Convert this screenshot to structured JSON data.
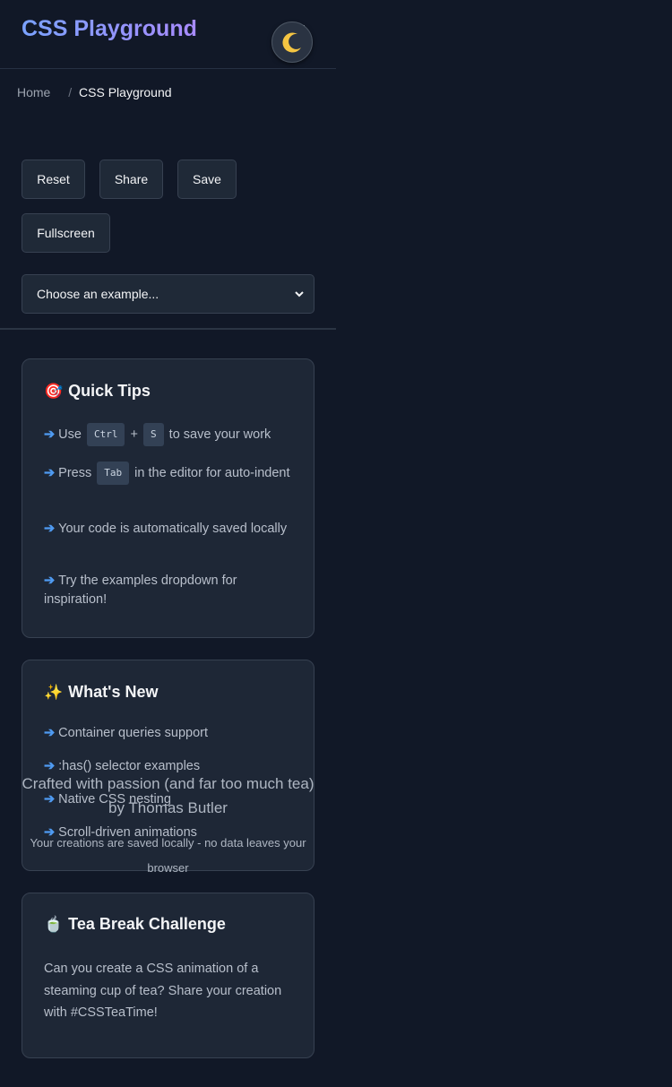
{
  "header": {
    "title": "CSS Playground"
  },
  "breadcrumb": {
    "home": "Home",
    "separator": "/",
    "current": "CSS Playground"
  },
  "toolbar": {
    "reset": "Reset",
    "share": "Share",
    "save": "Save",
    "fullscreen": "Fullscreen"
  },
  "examples_select": {
    "selected": "Choose an example..."
  },
  "quick_tips": {
    "emoji": "🎯",
    "title": "Quick Tips",
    "arrow": "➔",
    "tip1": {
      "before": "Use",
      "key1": "Ctrl",
      "plus": "+",
      "key2": "S",
      "after": "to save your work"
    },
    "tip2": {
      "before": "Press",
      "key": "Tab",
      "after": "in the editor for auto-indent"
    },
    "tip3": "Your code is automatically saved locally",
    "tip4": "Try the examples dropdown for inspiration!"
  },
  "whats_new": {
    "emoji": "✨",
    "title": "What's New",
    "arrow": "➔",
    "items": [
      "Container queries support",
      ":has() selector examples",
      "Native CSS nesting",
      "Scroll-driven animations"
    ]
  },
  "footer": {
    "credit_line1": "Crafted with passion (and far too much tea)",
    "credit_line2": "by Thomas Butler",
    "privacy": "Your creations are saved locally - no data leaves your browser"
  },
  "tea_challenge": {
    "emoji": "🍵",
    "title": "Tea Break Challenge",
    "text": "Can you create a CSS animation of a steaming cup of tea? Share your creation with #CSSTeaTime!"
  },
  "colors": {
    "background": "#111827",
    "card": "#1e2736",
    "accent": "#4f9bf2",
    "moon": "#f5c542"
  },
  "icons": {
    "theme_toggle": "moon-icon",
    "select_caret": "chevron-down-icon"
  }
}
